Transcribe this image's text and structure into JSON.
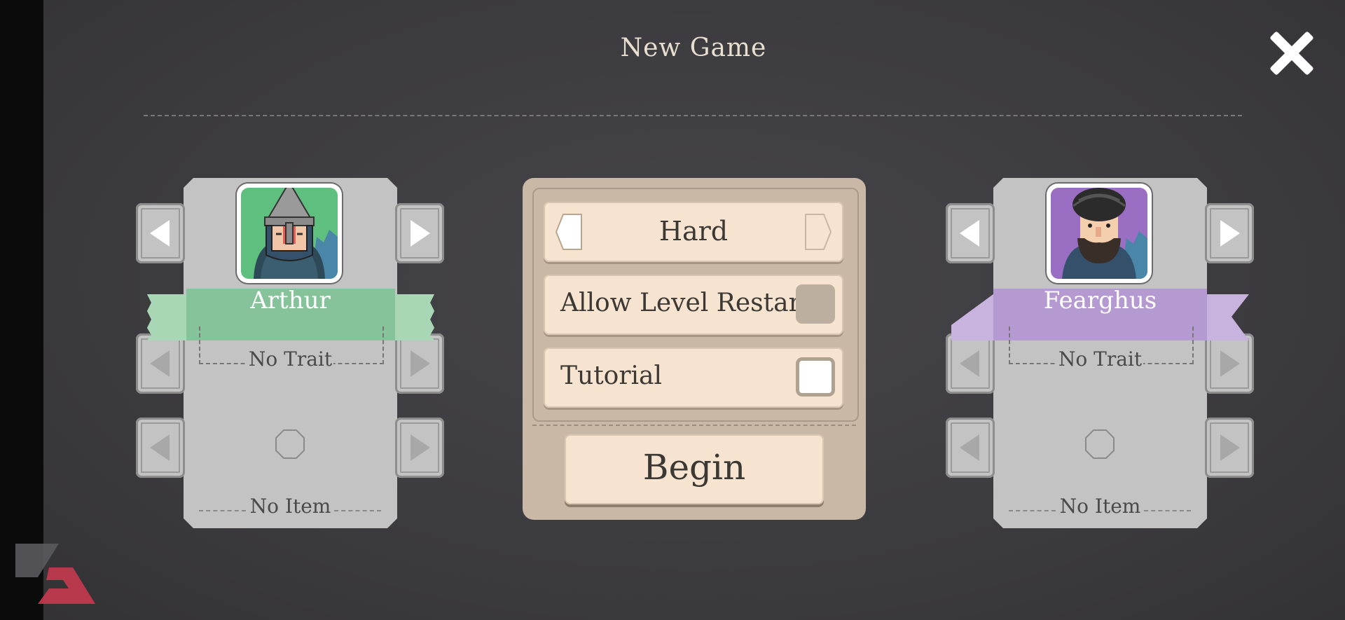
{
  "screen": {
    "title": "New Game"
  },
  "left_character": {
    "name": "Arthur",
    "trait": "No Trait",
    "item": "No Item",
    "banner_color": "#86c29a",
    "portrait_bg": "#5fbf7e",
    "portrait_icon": "knight-helmet-portrait"
  },
  "right_character": {
    "name": "Fearghus",
    "trait": "No Trait",
    "item": "No Item",
    "banner_color": "#b49ad0",
    "portrait_bg": "#9a6fc3",
    "portrait_icon": "bearded-man-portrait"
  },
  "settings": {
    "difficulty": "Hard",
    "allow_restarts_label": "Allow Level Restarts",
    "allow_restarts_checked": false,
    "tutorial_label": "Tutorial",
    "tutorial_checked": false,
    "begin_label": "Begin"
  },
  "colors": {
    "background": "#3c3b3e",
    "panel": "#c9b8a6",
    "button": "#f6e4d1",
    "card": "#c4c3c3"
  }
}
